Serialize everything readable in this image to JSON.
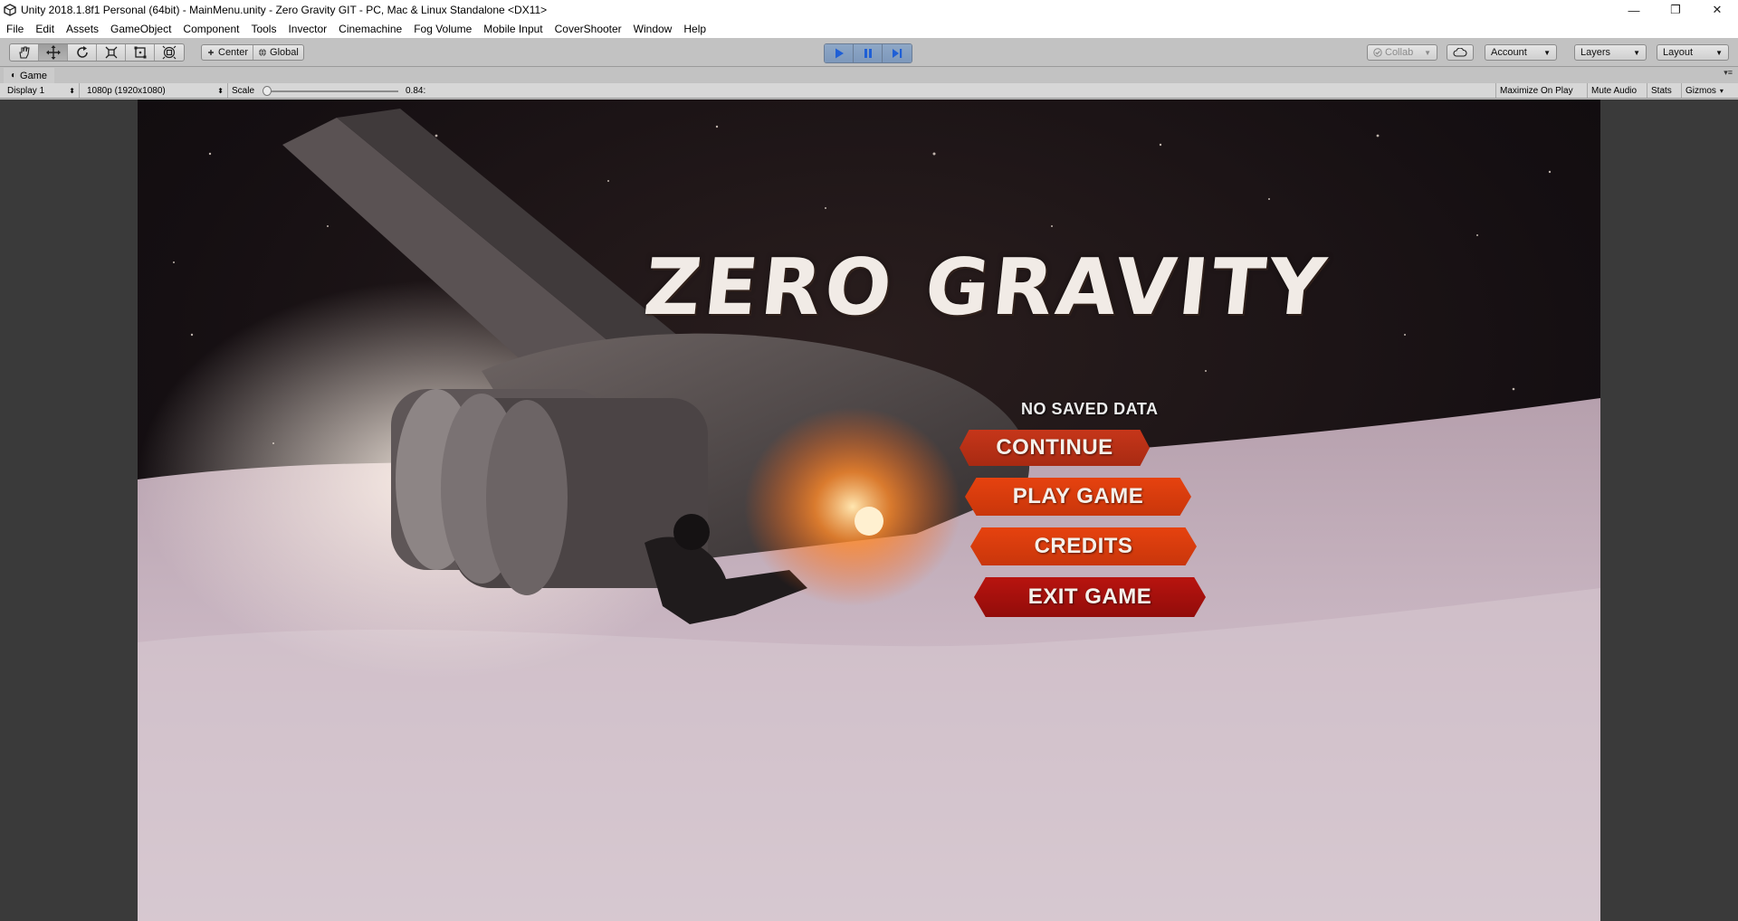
{
  "window": {
    "title": "Unity 2018.1.8f1 Personal (64bit) - MainMenu.unity - Zero Gravity GIT - PC, Mac & Linux Standalone <DX11>",
    "controls": {
      "minimize": "—",
      "restore": "❐",
      "close": "✕"
    }
  },
  "menubar": {
    "items": [
      "File",
      "Edit",
      "Assets",
      "GameObject",
      "Component",
      "Tools",
      "Invector",
      "Cinemachine",
      "Fog Volume",
      "Mobile Input",
      "CoverShooter",
      "Window",
      "Help"
    ]
  },
  "toolbar": {
    "transform_tools": [
      "hand-tool-icon",
      "move-tool-icon",
      "rotate-tool-icon",
      "scale-tool-icon",
      "rect-tool-icon",
      "transform-tool-icon"
    ],
    "pivot_mode": "Center",
    "pivot_rotation": "Global",
    "playback": {
      "playing": true
    },
    "collab_label": "Collab",
    "account_label": "Account",
    "layers_label": "Layers",
    "layout_label": "Layout"
  },
  "game_tab": {
    "label": "Game"
  },
  "game_toolbar": {
    "display": "Display 1",
    "resolution": "1080p (1920x1080)",
    "scale_label": "Scale",
    "scale_value": "0.84:",
    "maximize_on_play": "Maximize On Play",
    "mute_audio": "Mute Audio",
    "stats": "Stats",
    "gizmos": "Gizmos"
  },
  "game": {
    "title": "ZERO GRAVITY",
    "save_status": "NO SAVED DATA",
    "menu": {
      "continue": "CONTINUE",
      "play_game": "PLAY GAME",
      "credits": "CREDITS",
      "exit_game": "EXIT GAME"
    }
  },
  "colors": {
    "editor_gray": "#c2c2c2",
    "play_blue": "#8ea7c6",
    "button_orange": "#e6420f",
    "button_red": "#b8140f"
  }
}
